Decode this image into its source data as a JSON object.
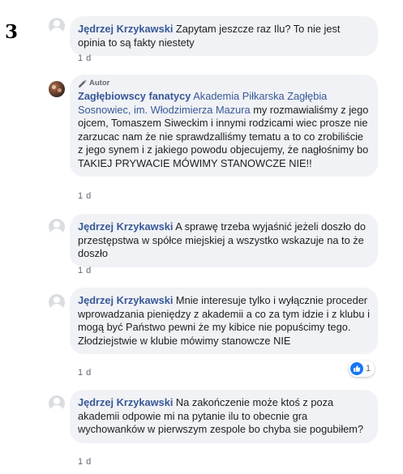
{
  "page_number": "3",
  "author_badge_label": "Autor",
  "comments": [
    {
      "author": "Jędrzej Krzykawski",
      "text": " Zapytam jeszcze raz Ilu? To nie jest opinia to są fakty niestety",
      "time": "1 d"
    },
    {
      "author": "Zagłębiowscy fanatycy",
      "mention": "Akademia Piłkarska Zagłębia Sosnowiec, im. Włodzimierza Mazura",
      "text": " my rozmawialiśmy z jego ojcem, Tomaszem Siweckim i innymi rodzicami wiec prosze nie zarzucac nam że nie sprawdzalliśmy tematu a to co zrobiliście z jego synem i z jakiego powodu objecujemy, że nagłośnimy bo TAKIEJ PRYWACIE MÓWIMY STANOWCZE NIE!!",
      "time": "1 d"
    },
    {
      "author": "Jędrzej Krzykawski",
      "text": " A sprawę trzeba wyjaśnić jeżeli doszło do przestępstwa w spółce miejskiej a wszystko wskazuje na to że doszło",
      "time": "1 d"
    },
    {
      "author": "Jędrzej Krzykawski",
      "text": " Mnie interesuje tylko i wyłącznie proceder wprowadzania pieniędzy z akademii a co za tym idzie i z klubu i mogą być Państwo pewni że my kibice nie popuścimy tego. Złodziejstwie w klubie mówimy stanowcze NIE",
      "time": "1 d",
      "reaction_count": "1"
    },
    {
      "author": "Jędrzej Krzykawski",
      "text": " Na zakończenie może ktoś z poza akademii odpowie mi na pytanie ilu to obecnie gra wychowanków w pierwszym zespole bo chyba sie pogubiłem?",
      "time": "1 d"
    }
  ],
  "colors": {
    "name_link": "#385898",
    "bubble_bg": "#f0f2f5",
    "like_blue": "#1877f2"
  }
}
